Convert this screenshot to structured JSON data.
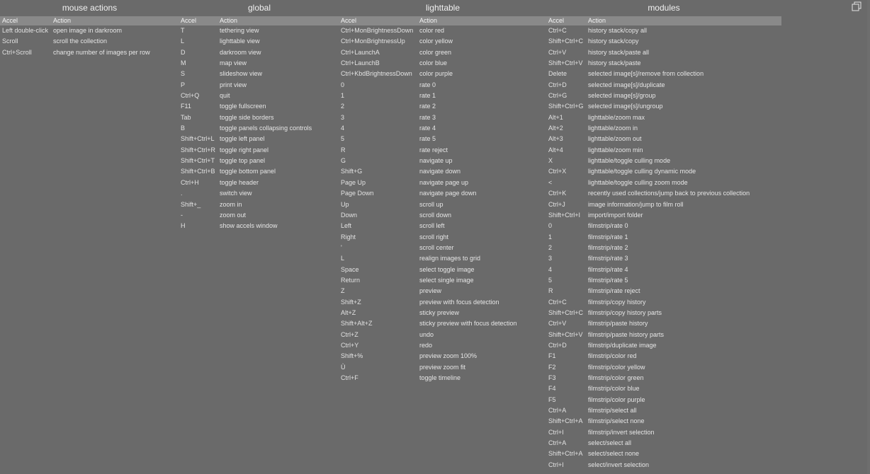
{
  "window": {
    "restore_icon": "restore-window-icon"
  },
  "columns_header": {
    "accel": "Accel",
    "action": "Action"
  },
  "sections": [
    {
      "title": "mouse actions",
      "rows": [
        {
          "accel": "Left double-click",
          "action": "open image in darkroom"
        },
        {
          "accel": "Scroll",
          "action": "scroll the collection"
        },
        {
          "accel": "Ctrl+Scroll",
          "action": "change number of images per row"
        }
      ]
    },
    {
      "title": "global",
      "rows": [
        {
          "accel": "T",
          "action": "tethering view"
        },
        {
          "accel": "L",
          "action": "lighttable view"
        },
        {
          "accel": "D",
          "action": "darkroom view"
        },
        {
          "accel": "M",
          "action": "map view"
        },
        {
          "accel": "S",
          "action": "slideshow view"
        },
        {
          "accel": "P",
          "action": "print view"
        },
        {
          "accel": "Ctrl+Q",
          "action": "quit"
        },
        {
          "accel": "F11",
          "action": "toggle fullscreen"
        },
        {
          "accel": "Tab",
          "action": "toggle side borders"
        },
        {
          "accel": "B",
          "action": "toggle panels collapsing controls"
        },
        {
          "accel": "Shift+Ctrl+L",
          "action": "toggle left panel"
        },
        {
          "accel": "Shift+Ctrl+R",
          "action": "toggle right panel"
        },
        {
          "accel": "Shift+Ctrl+T",
          "action": "toggle top panel"
        },
        {
          "accel": "Shift+Ctrl+B",
          "action": "toggle bottom panel"
        },
        {
          "accel": "Ctrl+H",
          "action": "toggle header"
        },
        {
          "accel": ".",
          "action": "switch view"
        },
        {
          "accel": "Shift+_",
          "action": "zoom in"
        },
        {
          "accel": "-",
          "action": "zoom out"
        },
        {
          "accel": "H",
          "action": "show accels window"
        }
      ]
    },
    {
      "title": "lighttable",
      "rows": [
        {
          "accel": "Ctrl+MonBrightnessDown",
          "action": "color red"
        },
        {
          "accel": "Ctrl+MonBrightnessUp",
          "action": "color yellow"
        },
        {
          "accel": "Ctrl+LaunchA",
          "action": "color green"
        },
        {
          "accel": "Ctrl+LaunchB",
          "action": "color blue"
        },
        {
          "accel": "Ctrl+KbdBrightnessDown",
          "action": "color purple"
        },
        {
          "accel": "0",
          "action": "rate 0"
        },
        {
          "accel": "1",
          "action": "rate 1"
        },
        {
          "accel": "2",
          "action": "rate 2"
        },
        {
          "accel": "3",
          "action": "rate 3"
        },
        {
          "accel": "4",
          "action": "rate 4"
        },
        {
          "accel": "5",
          "action": "rate 5"
        },
        {
          "accel": "R",
          "action": "rate reject"
        },
        {
          "accel": "G",
          "action": "navigate up"
        },
        {
          "accel": "Shift+G",
          "action": "navigate down"
        },
        {
          "accel": "Page Up",
          "action": "navigate page up"
        },
        {
          "accel": "Page Down",
          "action": "navigate page down"
        },
        {
          "accel": "Up",
          "action": "scroll up"
        },
        {
          "accel": "Down",
          "action": "scroll down"
        },
        {
          "accel": "Left",
          "action": "scroll left"
        },
        {
          "accel": "Right",
          "action": "scroll right"
        },
        {
          "accel": "'",
          "action": "scroll center"
        },
        {
          "accel": "L",
          "action": "realign images to grid"
        },
        {
          "accel": "Space",
          "action": "select toggle image"
        },
        {
          "accel": "Return",
          "action": "select single image"
        },
        {
          "accel": "Z",
          "action": "preview"
        },
        {
          "accel": "Shift+Z",
          "action": "preview with focus detection"
        },
        {
          "accel": "Alt+Z",
          "action": "sticky preview"
        },
        {
          "accel": "Shift+Alt+Z",
          "action": "sticky preview with focus detection"
        },
        {
          "accel": "Ctrl+Z",
          "action": "undo"
        },
        {
          "accel": "Ctrl+Y",
          "action": "redo"
        },
        {
          "accel": "Shift+%",
          "action": "preview zoom 100%"
        },
        {
          "accel": "Ù",
          "action": "preview zoom fit"
        },
        {
          "accel": "Ctrl+F",
          "action": "toggle timeline"
        }
      ]
    },
    {
      "title": "modules",
      "rows": [
        {
          "accel": "Ctrl+C",
          "action": "history stack/copy all"
        },
        {
          "accel": "Shift+Ctrl+C",
          "action": "history stack/copy"
        },
        {
          "accel": "Ctrl+V",
          "action": "history stack/paste all"
        },
        {
          "accel": "Shift+Ctrl+V",
          "action": "history stack/paste"
        },
        {
          "accel": "Delete",
          "action": "selected image[s]/remove from collection"
        },
        {
          "accel": "Ctrl+D",
          "action": "selected image[s]/duplicate"
        },
        {
          "accel": "Ctrl+G",
          "action": "selected image[s]/group"
        },
        {
          "accel": "Shift+Ctrl+G",
          "action": "selected image[s]/ungroup"
        },
        {
          "accel": "Alt+1",
          "action": "lighttable/zoom max"
        },
        {
          "accel": "Alt+2",
          "action": "lighttable/zoom in"
        },
        {
          "accel": "Alt+3",
          "action": "lighttable/zoom out"
        },
        {
          "accel": "Alt+4",
          "action": "lighttable/zoom min"
        },
        {
          "accel": "X",
          "action": "lighttable/toggle culling mode"
        },
        {
          "accel": "Ctrl+X",
          "action": "lighttable/toggle culling dynamic mode"
        },
        {
          "accel": "<",
          "action": "lighttable/toggle culling zoom mode"
        },
        {
          "accel": "Ctrl+K",
          "action": "recently used collections/jump back to previous collection"
        },
        {
          "accel": "Ctrl+J",
          "action": "image information/jump to film roll"
        },
        {
          "accel": "Shift+Ctrl+I",
          "action": "import/import folder"
        },
        {
          "accel": "0",
          "action": "filmstrip/rate 0"
        },
        {
          "accel": "1",
          "action": "filmstrip/rate 1"
        },
        {
          "accel": "2",
          "action": "filmstrip/rate 2"
        },
        {
          "accel": "3",
          "action": "filmstrip/rate 3"
        },
        {
          "accel": "4",
          "action": "filmstrip/rate 4"
        },
        {
          "accel": "5",
          "action": "filmstrip/rate 5"
        },
        {
          "accel": "R",
          "action": "filmstrip/rate reject"
        },
        {
          "accel": "Ctrl+C",
          "action": "filmstrip/copy history"
        },
        {
          "accel": "Shift+Ctrl+C",
          "action": "filmstrip/copy history parts"
        },
        {
          "accel": "Ctrl+V",
          "action": "filmstrip/paste history"
        },
        {
          "accel": "Shift+Ctrl+V",
          "action": "filmstrip/paste history parts"
        },
        {
          "accel": "Ctrl+D",
          "action": "filmstrip/duplicate image"
        },
        {
          "accel": "F1",
          "action": "filmstrip/color red"
        },
        {
          "accel": "F2",
          "action": "filmstrip/color yellow"
        },
        {
          "accel": "F3",
          "action": "filmstrip/color green"
        },
        {
          "accel": "F4",
          "action": "filmstrip/color blue"
        },
        {
          "accel": "F5",
          "action": "filmstrip/color purple"
        },
        {
          "accel": "Ctrl+A",
          "action": "filmstrip/select all"
        },
        {
          "accel": "Shift+Ctrl+A",
          "action": "filmstrip/select none"
        },
        {
          "accel": "Ctrl+I",
          "action": "filmstrip/invert selection"
        },
        {
          "accel": "Ctrl+A",
          "action": "select/select all"
        },
        {
          "accel": "Shift+Ctrl+A",
          "action": "select/select none"
        },
        {
          "accel": "Ctrl+I",
          "action": "select/invert selection"
        }
      ]
    }
  ]
}
